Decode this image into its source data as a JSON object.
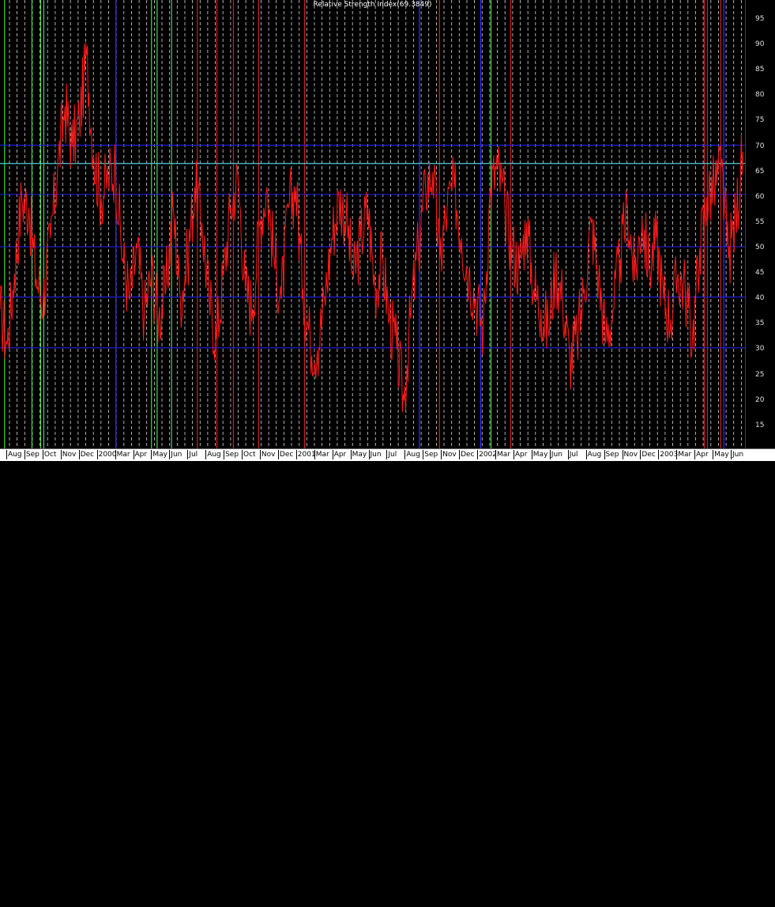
{
  "chart_data": {
    "type": "line",
    "title": "Relative Strength Index(69.3849)",
    "y_ticks": [
      15,
      20,
      25,
      30,
      35,
      40,
      45,
      50,
      55,
      60,
      65,
      70,
      75,
      80,
      85,
      90,
      95
    ],
    "ylim": [
      10.6,
      98.9
    ],
    "x_tick_labels": [
      "Aug",
      "Sep",
      "Oct",
      "Nov",
      "Dec",
      "2000",
      "Mar",
      "Apr",
      "May",
      "Jun",
      "Jul",
      "Aug",
      "Sep",
      "Oct",
      "Nov",
      "Dec",
      "2001",
      "Mar",
      "Apr",
      "May",
      "Jun",
      "Jul",
      "Aug",
      "Sep",
      "Nov",
      "Dec",
      "2002",
      "Mar",
      "Apr",
      "May",
      "Jun",
      "Jul",
      "Aug",
      "Sep",
      "Nov",
      "Dec",
      "2003",
      "Mar",
      "Apr",
      "May",
      "Jun"
    ],
    "x_range": [
      "1999-07-15",
      "2003-06-30"
    ],
    "horizontal_lines": [
      {
        "value": 70.3,
        "color": "#1f1fd6"
      },
      {
        "value": 66.7,
        "color": "#4fd0d8"
      },
      {
        "value": 60.6,
        "color": "#1f1fd6"
      },
      {
        "value": 50.3,
        "color": "#1f1fd6"
      },
      {
        "value": 40.4,
        "color": "#1f1fd6"
      },
      {
        "value": 30.4,
        "color": "#1f1fd6"
      }
    ],
    "vertical_markers": [
      {
        "date": "1999-07-24",
        "color": "#4fd34f"
      },
      {
        "date": "1999-09-15",
        "color": "#4fd34f"
      },
      {
        "date": "1999-10-02",
        "color": "#4fd34f"
      },
      {
        "date": "1999-10-08",
        "color": "#4fd34f"
      },
      {
        "date": "2000-02-25",
        "color": "#3030ff"
      },
      {
        "date": "2000-05-04",
        "color": "#4fd34f"
      },
      {
        "date": "2000-05-15",
        "color": "#4fd34f"
      },
      {
        "date": "2000-06-12",
        "color": "#4fd34f"
      },
      {
        "date": "2000-08-01",
        "color": "#d02020"
      },
      {
        "date": "2000-09-08",
        "color": "#d02020"
      },
      {
        "date": "2000-10-10",
        "color": "#d02020"
      },
      {
        "date": "2000-11-28",
        "color": "#d02020"
      },
      {
        "date": "2001-02-25",
        "color": "#d02020"
      },
      {
        "date": "2001-10-06",
        "color": "#3030ff"
      },
      {
        "date": "2001-11-14",
        "color": "#d02020"
      },
      {
        "date": "2002-02-02",
        "color": "#3030ff"
      },
      {
        "date": "2002-02-22",
        "color": "#4fd34f"
      },
      {
        "date": "2002-04-01",
        "color": "#d02020"
      },
      {
        "date": "2003-04-12",
        "color": "#d02020"
      },
      {
        "date": "2003-04-18",
        "color": "#d02020"
      },
      {
        "date": "2003-05-14",
        "color": "#d02020"
      },
      {
        "date": "2003-05-20",
        "color": "#3030ff"
      }
    ],
    "series": [
      {
        "color": "#ff1a1a",
        "x": [
          "1999-07-15",
          "1999-07-29",
          "1999-08-12",
          "1999-08-26",
          "1999-09-09",
          "1999-09-23",
          "1999-10-07",
          "1999-10-21",
          "1999-11-04",
          "1999-11-18",
          "1999-12-02",
          "1999-12-16",
          "1999-12-30",
          "2000-01-13",
          "2000-01-27",
          "2000-02-10",
          "2000-02-24",
          "2000-03-09",
          "2000-03-23",
          "2000-04-06",
          "2000-04-20",
          "2000-05-04",
          "2000-05-18",
          "2000-06-01",
          "2000-06-15",
          "2000-06-29",
          "2000-07-13",
          "2000-07-27",
          "2000-08-10",
          "2000-08-24",
          "2000-09-07",
          "2000-09-21",
          "2000-10-05",
          "2000-10-19",
          "2000-11-02",
          "2000-11-16",
          "2000-11-30",
          "2000-12-14",
          "2000-12-28",
          "2001-01-11",
          "2001-01-25",
          "2001-02-08",
          "2001-02-22",
          "2001-03-08",
          "2001-03-22",
          "2001-04-05",
          "2001-04-19",
          "2001-05-03",
          "2001-05-17",
          "2001-05-31",
          "2001-06-14",
          "2001-06-28",
          "2001-07-12",
          "2001-07-26",
          "2001-08-09",
          "2001-08-23",
          "2001-09-06",
          "2001-09-20",
          "2001-10-04",
          "2001-10-18",
          "2001-11-01",
          "2001-11-15",
          "2001-11-29",
          "2001-12-13",
          "2001-12-27",
          "2002-01-10",
          "2002-01-24",
          "2002-02-07",
          "2002-02-21",
          "2002-03-07",
          "2002-03-21",
          "2002-04-04",
          "2002-04-18",
          "2002-05-02",
          "2002-05-16",
          "2002-05-30",
          "2002-06-13",
          "2002-06-27",
          "2002-07-11",
          "2002-07-25",
          "2002-08-08",
          "2002-08-22",
          "2002-09-05",
          "2002-09-19",
          "2002-10-03",
          "2002-10-17",
          "2002-10-31",
          "2002-11-14",
          "2002-11-28",
          "2002-12-12",
          "2002-12-26",
          "2003-01-09",
          "2003-01-23",
          "2003-02-06",
          "2003-02-20",
          "2003-03-06",
          "2003-03-20",
          "2003-04-03",
          "2003-04-17",
          "2003-05-01",
          "2003-05-15",
          "2003-05-29",
          "2003-06-12",
          "2003-06-26"
        ],
        "values": [
          38,
          31,
          45,
          60,
          58,
          44,
          40,
          52,
          66,
          78,
          70,
          75,
          88,
          68,
          60,
          64,
          66,
          48,
          40,
          50,
          37,
          45,
          36,
          42,
          58,
          40,
          48,
          62,
          55,
          40,
          32,
          45,
          58,
          64,
          42,
          38,
          55,
          62,
          48,
          40,
          58,
          62,
          42,
          32,
          30,
          40,
          52,
          60,
          56,
          44,
          52,
          58,
          42,
          48,
          36,
          30,
          20,
          38,
          50,
          62,
          65,
          48,
          58,
          62,
          52,
          45,
          40,
          34,
          62,
          66,
          58,
          50,
          46,
          55,
          42,
          38,
          34,
          46,
          40,
          28,
          32,
          42,
          55,
          44,
          32,
          38,
          48,
          58,
          44,
          56,
          46,
          52,
          40,
          36,
          45,
          42,
          32,
          50,
          60,
          62,
          66,
          48,
          56,
          69
        ]
      }
    ],
    "grid": true
  }
}
